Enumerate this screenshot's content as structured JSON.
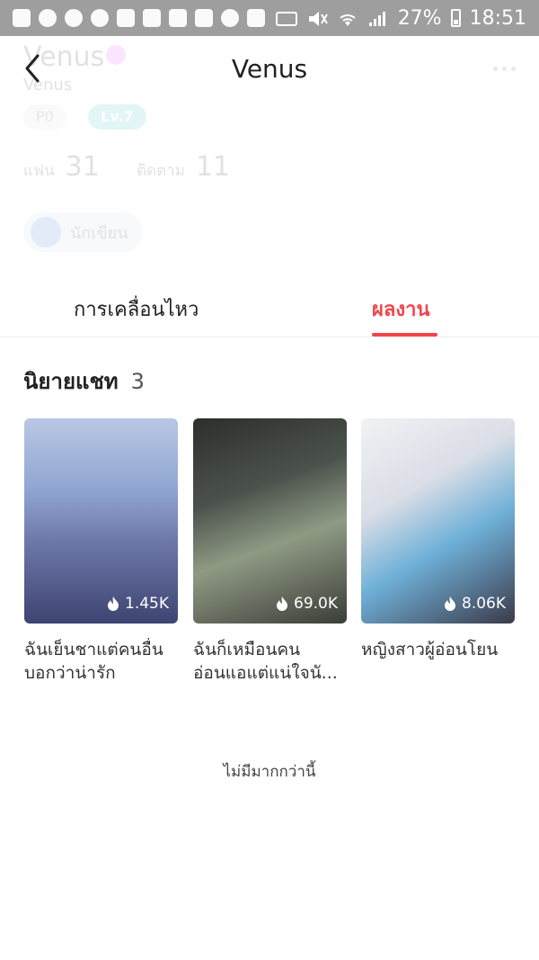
{
  "status_bar": {
    "battery": "27%",
    "time": "18:51"
  },
  "profile": {
    "name": "Venus",
    "username": "Venus",
    "power_badge": "P0",
    "level_badge": "Lv.7",
    "fans_label": "แฟน",
    "fans_count": "31",
    "following_label": "ติดตาม",
    "following_count": "11",
    "writer_badge": "นักเขียน"
  },
  "header": {
    "title": "Venus"
  },
  "tabs": [
    {
      "label": "การเคลื่อนไหว"
    },
    {
      "label": "ผลงาน"
    }
  ],
  "section": {
    "title": "นิยายแชท",
    "count": "3",
    "items": [
      {
        "title": "ฉันเย็นชาแต่คนอื่นบอกว่าน่ารัก",
        "heat": "1.45K"
      },
      {
        "title": "ฉันก็เหมือนคนอ่อนแอแต่แน่ใจนั...",
        "heat": "69.0K"
      },
      {
        "title": "หญิงสาวผู้อ่อนโยน",
        "heat": "8.06K"
      }
    ]
  },
  "footer": {
    "text": "ไม่มีมากกว่านี้"
  },
  "colors": {
    "accent": "#f0454c",
    "level_badge": "#2bb8c7"
  },
  "icons": [
    "back-arrow-icon",
    "more-dots-icon",
    "flame-icon",
    "writer-pen-icon",
    "gender-icon"
  ]
}
